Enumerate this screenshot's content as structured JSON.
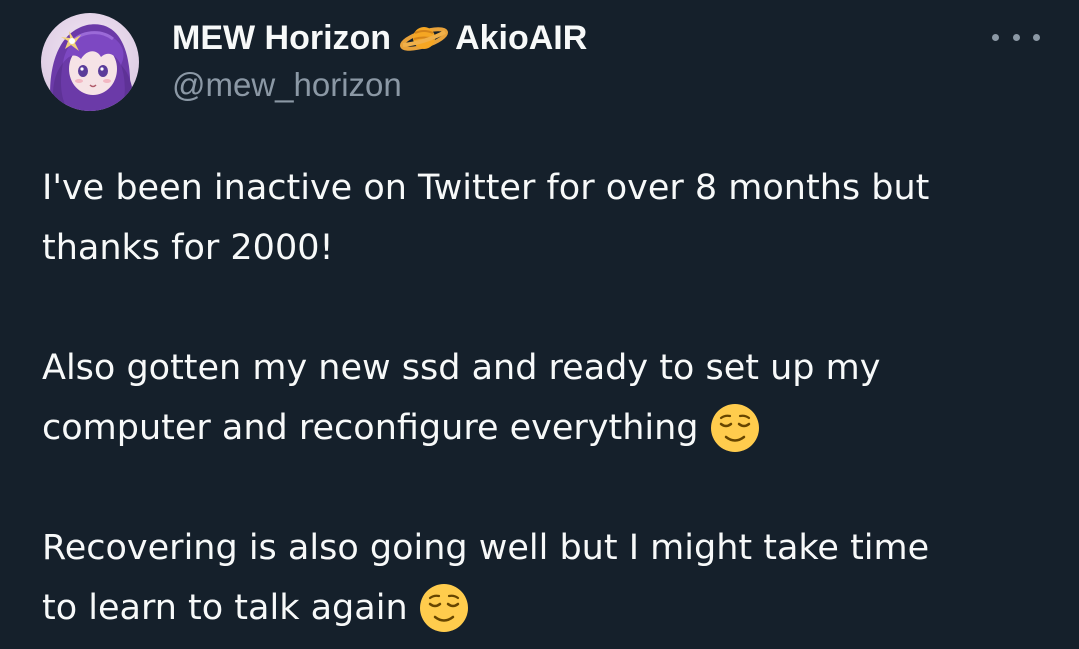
{
  "author": {
    "display_name": "MEW Horizon",
    "name_suffix": "AkioAIR",
    "handle": "@mew_horizon",
    "avatar_icon": "anime-girl-avatar",
    "name_emoji_icon": "ringed-planet-icon"
  },
  "tweet": {
    "paragraphs": [
      {
        "lines": [
          "I've been inactive on Twitter for over 8 months but",
          "thanks for 2000!"
        ]
      },
      {
        "lines": [
          "Also gotten my new ssd and ready to set up my",
          "computer and reconfigure everything"
        ],
        "trailing_emoji": "relieved-face-emoji"
      },
      {
        "lines": [
          "Recovering is also going well but I might take time",
          "to learn to talk again"
        ],
        "trailing_emoji": "relieved-face-emoji"
      }
    ]
  },
  "menu": {
    "icon": "more-options-icon"
  },
  "colors": {
    "background": "#15202b",
    "primary_text": "#f7f9f9",
    "secondary_text": "#8b98a5"
  }
}
